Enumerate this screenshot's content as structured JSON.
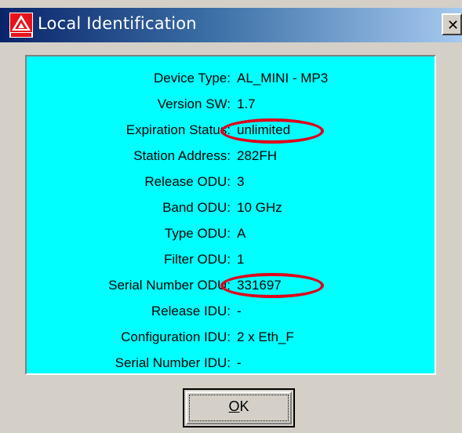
{
  "window": {
    "title": "Local Identification",
    "close_glyph": "✕",
    "colors": {
      "title_start": "#0a246a",
      "title_end": "#a6caf0",
      "panel_bg": "#00ffff",
      "highlight": "#e0001a"
    }
  },
  "identification": {
    "rows": [
      {
        "label": "Device Type:",
        "value": "AL_MINI - MP3"
      },
      {
        "label": "Version SW:",
        "value": "1.7"
      },
      {
        "label": "Expiration Status:",
        "value": "unlimited"
      },
      {
        "label": "Station Address:",
        "value": "282FH"
      },
      {
        "label": "Release ODU:",
        "value": "3"
      },
      {
        "label": "Band ODU:",
        "value": "10 GHz"
      },
      {
        "label": "Type ODU:",
        "value": "A"
      },
      {
        "label": "Filter ODU:",
        "value": "1"
      },
      {
        "label": "Serial Number ODU:",
        "value": "331697"
      },
      {
        "label": "Release IDU:",
        "value": "-"
      },
      {
        "label": "Configuration IDU:",
        "value": "2 x Eth_F"
      },
      {
        "label": "Serial Number IDU:",
        "value": "-"
      }
    ]
  },
  "buttons": {
    "ok_mnemonic": "O",
    "ok_rest": "K"
  },
  "icons": {
    "app": "app-logo-icon",
    "close": "close-icon"
  }
}
